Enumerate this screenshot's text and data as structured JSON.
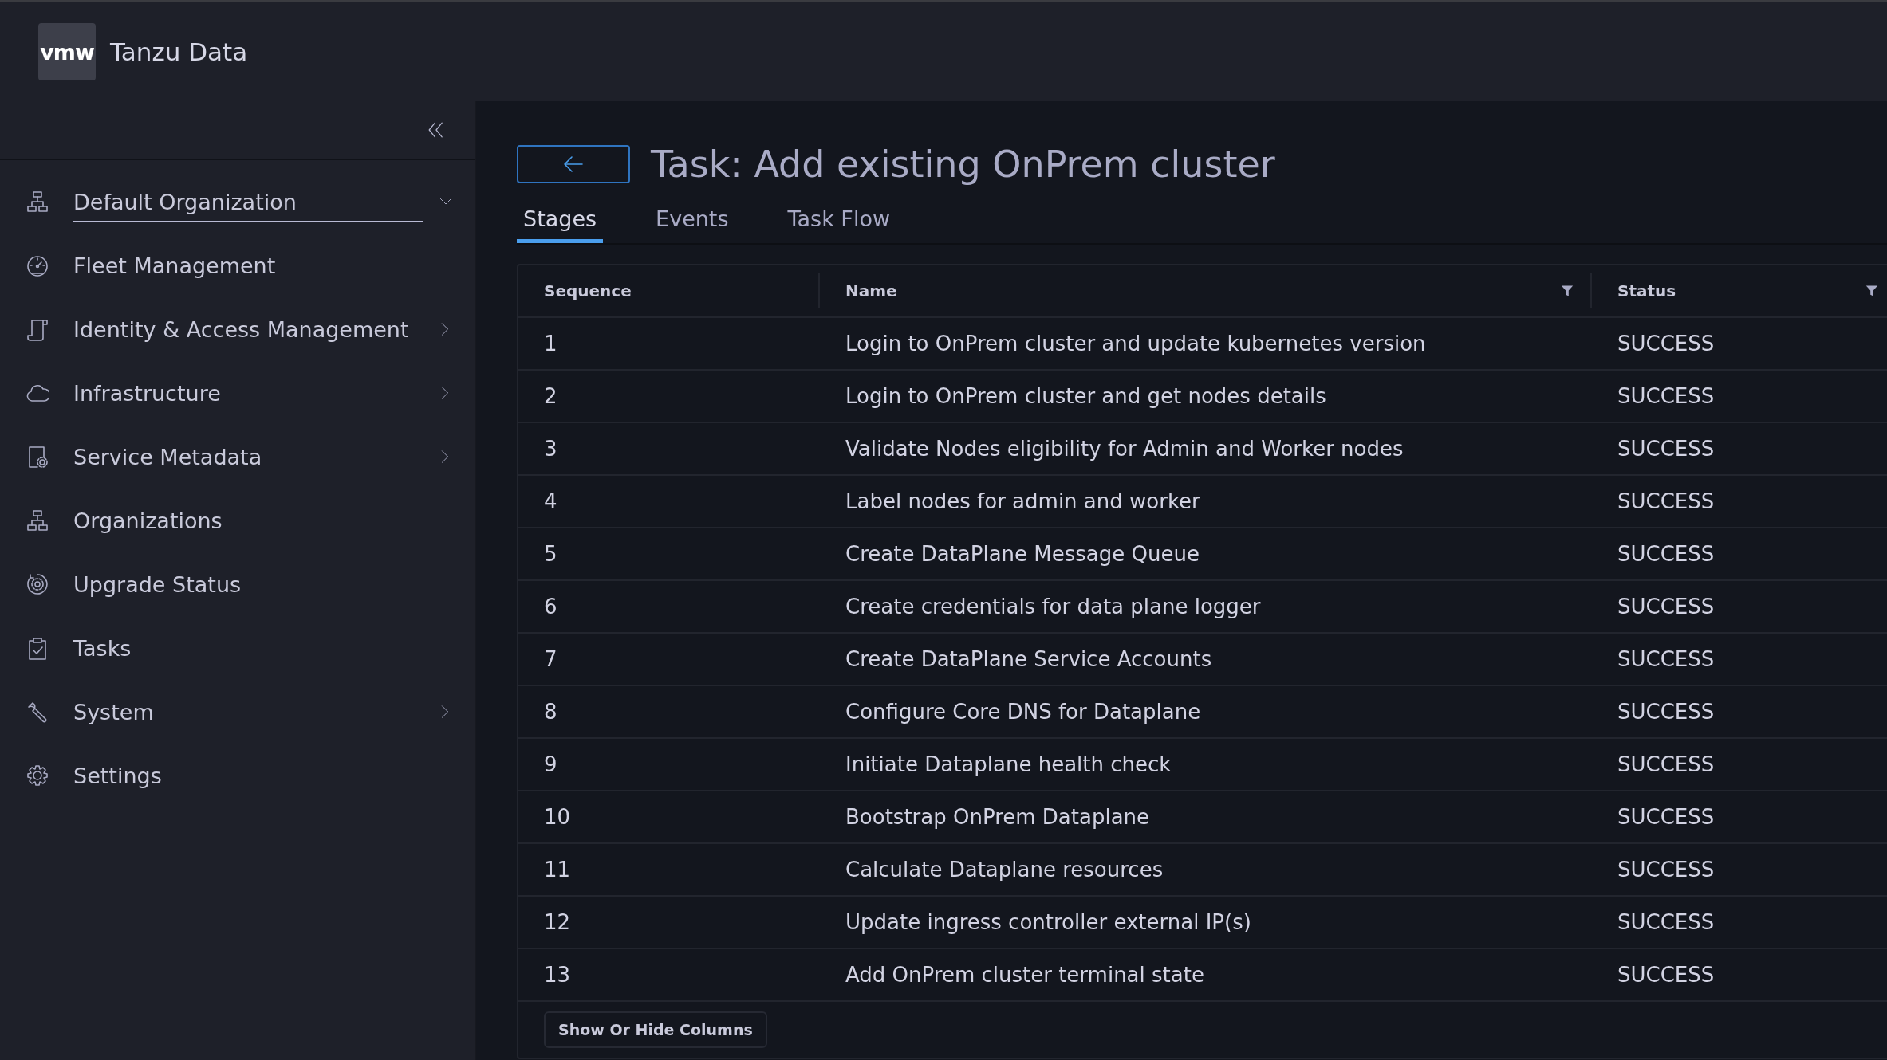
{
  "app": {
    "logo": "vmw",
    "title": "Tanzu Data"
  },
  "sidebar": {
    "org_selector": {
      "value": "Default Organization"
    },
    "items": [
      {
        "label": "Fleet Management",
        "has_submenu": false
      },
      {
        "label": "Identity & Access Management",
        "has_submenu": true
      },
      {
        "label": "Infrastructure",
        "has_submenu": true
      },
      {
        "label": "Service Metadata",
        "has_submenu": true
      },
      {
        "label": "Organizations",
        "has_submenu": false
      },
      {
        "label": "Upgrade Status",
        "has_submenu": false
      },
      {
        "label": "Tasks",
        "has_submenu": false
      },
      {
        "label": "System",
        "has_submenu": true
      },
      {
        "label": "Settings",
        "has_submenu": false
      }
    ]
  },
  "page": {
    "title": "Task: Add existing OnPrem cluster",
    "tabs": [
      {
        "label": "Stages",
        "selected": true
      },
      {
        "label": "Events",
        "selected": false
      },
      {
        "label": "Task Flow",
        "selected": false
      }
    ],
    "table": {
      "columns": [
        {
          "label": "Sequence",
          "filter": false
        },
        {
          "label": "Name",
          "filter": true
        },
        {
          "label": "Status",
          "filter": true
        }
      ],
      "rows": [
        [
          "1",
          "Login to OnPrem cluster and update kubernetes version",
          "SUCCESS"
        ],
        [
          "2",
          "Login to OnPrem cluster and get nodes details",
          "SUCCESS"
        ],
        [
          "3",
          "Validate Nodes eligibility for Admin and Worker nodes",
          "SUCCESS"
        ],
        [
          "4",
          "Label nodes for admin and worker",
          "SUCCESS"
        ],
        [
          "5",
          "Create DataPlane Message Queue",
          "SUCCESS"
        ],
        [
          "6",
          "Create credentials for data plane logger",
          "SUCCESS"
        ],
        [
          "7",
          "Create DataPlane Service Accounts",
          "SUCCESS"
        ],
        [
          "8",
          "Configure Core DNS for Dataplane",
          "SUCCESS"
        ],
        [
          "9",
          "Initiate Dataplane health check",
          "SUCCESS"
        ],
        [
          "10",
          "Bootstrap OnPrem Dataplane",
          "SUCCESS"
        ],
        [
          "11",
          "Calculate Dataplane resources",
          "SUCCESS"
        ],
        [
          "12",
          "Update ingress controller external IP(s)",
          "SUCCESS"
        ],
        [
          "13",
          "Add OnPrem cluster terminal state",
          "SUCCESS"
        ]
      ]
    },
    "columns_button": "Show Or Hide Columns"
  }
}
